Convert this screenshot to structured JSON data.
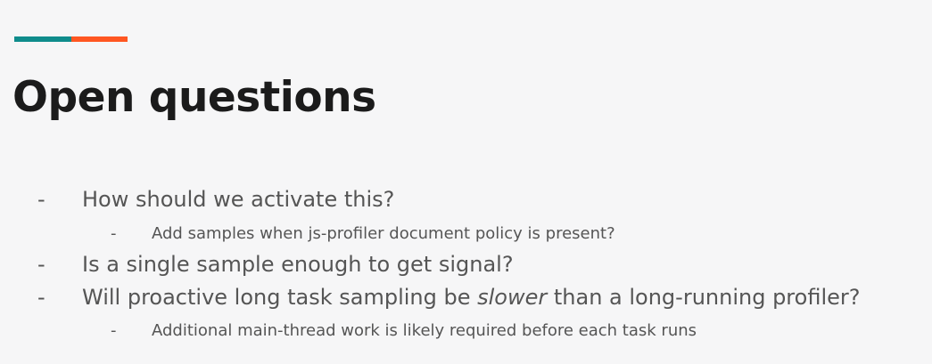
{
  "slide": {
    "title": "Open questions",
    "accent_colors": [
      "#0f8c8c",
      "#ff5722"
    ],
    "bullet_marker": "-",
    "bullets": [
      {
        "level": 1,
        "text": "How should we activate this?"
      },
      {
        "level": 2,
        "text": "Add samples when js-profiler document policy is present?"
      },
      {
        "level": 1,
        "text": "Is a single sample enough to get signal?"
      },
      {
        "level": 1,
        "text_before": "Will proactive long task sampling be ",
        "text_emphasis": "slower",
        "text_after": " than a long-running profiler?"
      },
      {
        "level": 2,
        "text": "Additional main-thread work is likely required before each task runs"
      }
    ]
  }
}
